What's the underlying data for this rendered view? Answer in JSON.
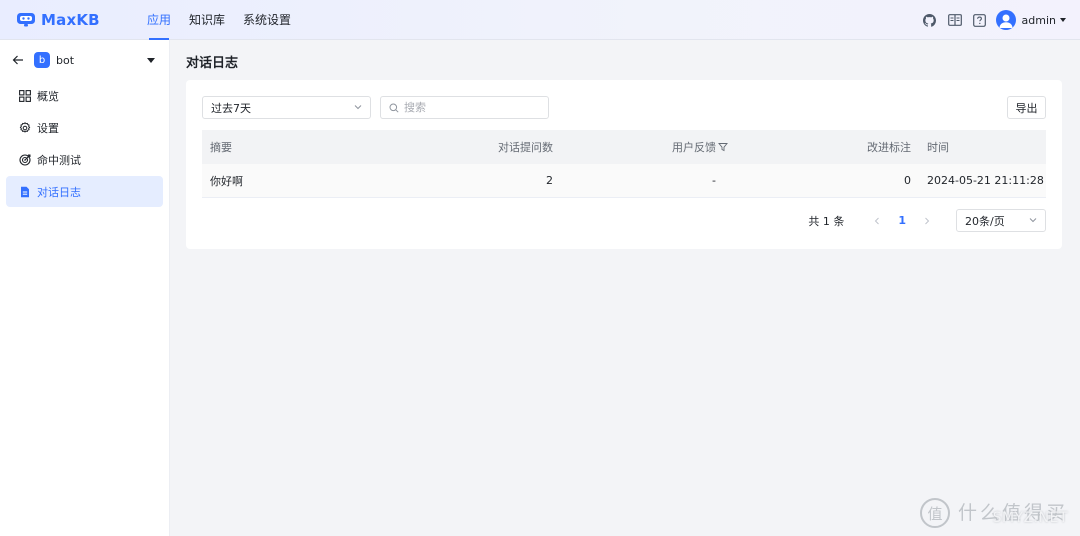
{
  "header": {
    "logo_text": "MaxKB",
    "nav": [
      {
        "label": "应用",
        "active": true
      },
      {
        "label": "知识库",
        "active": false
      },
      {
        "label": "系统设置",
        "active": false
      }
    ],
    "user_name": "admin",
    "icons": [
      "github-icon",
      "book-icon",
      "help-icon",
      "user-avatar"
    ]
  },
  "sidebar": {
    "app_badge": "b",
    "app_name": "bot",
    "items": [
      {
        "label": "概览",
        "icon": "grid-icon",
        "active": false
      },
      {
        "label": "设置",
        "icon": "gear-icon",
        "active": false
      },
      {
        "label": "命中测试",
        "icon": "target-icon",
        "active": false
      },
      {
        "label": "对话日志",
        "icon": "document-icon",
        "active": true
      }
    ]
  },
  "main": {
    "title": "对话日志",
    "date_filter": "过去7天",
    "search_placeholder": "搜索",
    "export_label": "导出",
    "table": {
      "headers": [
        "摘要",
        "对话提问数",
        "用户反馈",
        "改进标注",
        "时间"
      ],
      "rows": [
        {
          "summary": "你好啊",
          "question_count": "2",
          "feedback": "-",
          "annotations": "0",
          "time": "2024-05-21 21:11:28"
        }
      ]
    },
    "pagination": {
      "total": "共 1 条",
      "current_page": "1",
      "page_size": "20条/页"
    }
  },
  "colors": {
    "accent": "#3370ff",
    "active_bg": "#e5edff"
  },
  "watermark": {
    "badge": "值",
    "text": "什么值得买",
    "sub": "SMYZ.NET"
  }
}
